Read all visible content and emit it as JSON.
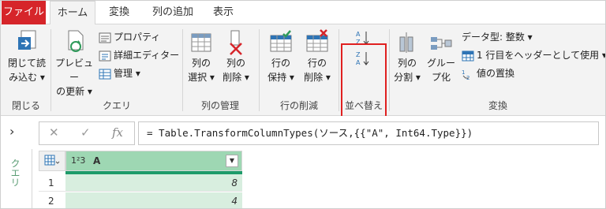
{
  "tabs": [
    {
      "label": "ファイル"
    },
    {
      "label": "ホーム"
    },
    {
      "label": "変換"
    },
    {
      "label": "列の追加"
    },
    {
      "label": "表示"
    }
  ],
  "ribbon": {
    "close": {
      "btn_line1": "閉じて読",
      "btn_line2": "み込む ▾",
      "group_label": "閉じる"
    },
    "query": {
      "preview_line1": "プレビュー",
      "preview_line2": "の更新 ▾",
      "properties": "プロパティ",
      "advanced_editor": "詳細エディター",
      "manage": "管理 ▾",
      "group_label": "クエリ"
    },
    "columns": {
      "select_line1": "列の",
      "select_line2": "選択 ▾",
      "delete_line1": "列の",
      "delete_line2": "削除 ▾",
      "group_label": "列の管理"
    },
    "rows": {
      "keep_line1": "行の",
      "keep_line2": "保持 ▾",
      "remove_line1": "行の",
      "remove_line2": "削除 ▾",
      "group_label": "行の削減"
    },
    "sort": {
      "group_label": "並べ替え"
    },
    "transform": {
      "split_line1": "列の",
      "split_line2": "分割 ▾",
      "group_line1": "グルー",
      "group_line2": "プ化",
      "data_type": "データ型: 整数 ▾",
      "first_row_header": "1 行目をヘッダーとして使用 ▾",
      "replace_values": "値の置換",
      "group_label": "変換"
    }
  },
  "formula_bar": {
    "collapse_glyph": "›",
    "cancel_glyph": "✕",
    "confirm_glyph": "✓",
    "fx_label": "fx",
    "formula": "= Table.TransformColumnTypes(ソース,{{\"A\", Int64.Type}})"
  },
  "query_pane": {
    "label": "クエリ"
  },
  "grid": {
    "type_indicator": "1²3",
    "column_header": "A",
    "rows": [
      {
        "num": "1",
        "value": "8"
      },
      {
        "num": "2",
        "value": "4"
      }
    ]
  }
}
